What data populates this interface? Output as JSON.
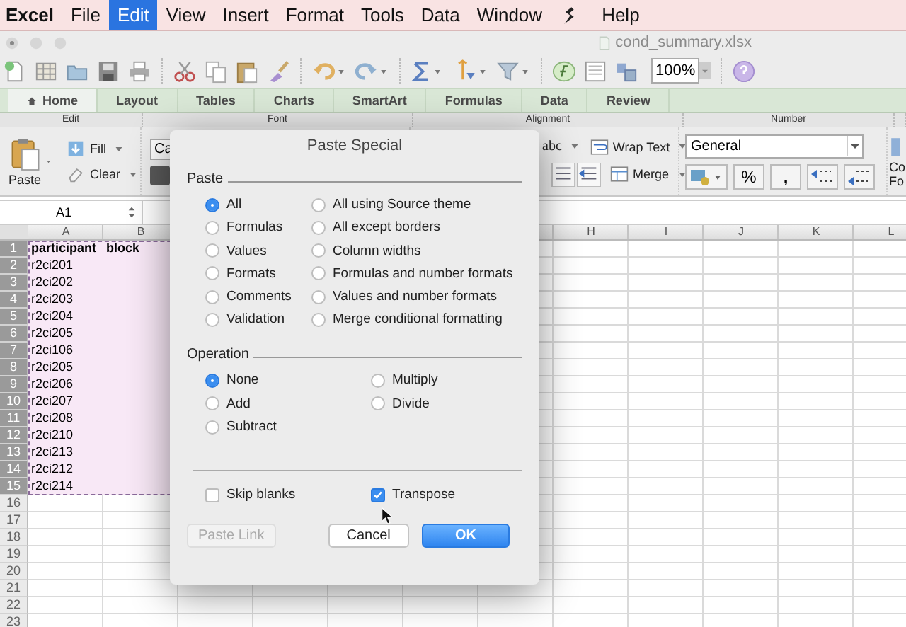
{
  "menu_bar": [
    {
      "kind": "app",
      "label": "Excel",
      "selected": false
    },
    {
      "kind": "menu",
      "label": "File",
      "selected": false
    },
    {
      "kind": "menu",
      "label": "Edit",
      "selected": true
    },
    {
      "kind": "menu",
      "label": "View",
      "selected": false
    },
    {
      "kind": "menu",
      "label": "Insert",
      "selected": false
    },
    {
      "kind": "menu",
      "label": "Format",
      "selected": false
    },
    {
      "kind": "menu",
      "label": "Tools",
      "selected": false
    },
    {
      "kind": "menu",
      "label": "Data",
      "selected": false
    },
    {
      "kind": "menu",
      "label": "Window",
      "selected": false
    },
    {
      "kind": "script",
      "selected": false
    },
    {
      "kind": "menu",
      "label": "Help",
      "selected": false
    }
  ],
  "window": {
    "title": "cond_summary.xlsx"
  },
  "toolbar": {
    "zoom": "100%"
  },
  "ribbon": {
    "tabs": [
      {
        "label": "Home",
        "selected": true
      },
      {
        "label": "Layout",
        "selected": false
      },
      {
        "label": "Tables",
        "selected": false
      },
      {
        "label": "Charts",
        "selected": false
      },
      {
        "label": "SmartArt",
        "selected": false
      },
      {
        "label": "Formulas",
        "selected": false
      },
      {
        "label": "Data",
        "selected": false
      },
      {
        "label": "Review",
        "selected": false
      }
    ],
    "groups": [
      "Edit",
      "Font",
      "Alignment",
      "Number"
    ],
    "edit": {
      "paste": "Paste",
      "fill": "Fill",
      "clear": "Clear"
    },
    "font": {
      "font_name": "Ca"
    },
    "alignment": {
      "orientation": "abc",
      "wrap_text": "Wrap Text",
      "merge": "Merge"
    },
    "number": {
      "format": "General",
      "percent": "%",
      "comma": ","
    },
    "cut_off_label": [
      "Co",
      "Fo"
    ]
  },
  "formula_bar": {
    "name_box": "A1"
  },
  "sheet": {
    "columns_left": [
      "A",
      "B"
    ],
    "columns_right": [
      "H",
      "I",
      "J",
      "K",
      "L"
    ],
    "rows": [
      {
        "number": "1",
        "kind": "header",
        "selected": true,
        "cells": [
          "participant",
          "block"
        ]
      },
      {
        "number": "2",
        "kind": "data",
        "selected": true,
        "cells": [
          "r2ci201"
        ]
      },
      {
        "number": "3",
        "kind": "data",
        "selected": true,
        "cells": [
          "r2ci202"
        ]
      },
      {
        "number": "4",
        "kind": "data",
        "selected": true,
        "cells": [
          "r2ci203"
        ]
      },
      {
        "number": "5",
        "kind": "data",
        "selected": true,
        "cells": [
          "r2ci204"
        ]
      },
      {
        "number": "6",
        "kind": "data",
        "selected": true,
        "cells": [
          "r2ci205"
        ]
      },
      {
        "number": "7",
        "kind": "data",
        "selected": true,
        "cells": [
          "r2ci106"
        ]
      },
      {
        "number": "8",
        "kind": "data",
        "selected": true,
        "cells": [
          "r2ci205"
        ]
      },
      {
        "number": "9",
        "kind": "data",
        "selected": true,
        "cells": [
          "r2ci206"
        ]
      },
      {
        "number": "10",
        "kind": "data",
        "selected": true,
        "cells": [
          "r2ci207"
        ]
      },
      {
        "number": "11",
        "kind": "data",
        "selected": true,
        "cells": [
          "r2ci208"
        ]
      },
      {
        "number": "12",
        "kind": "data",
        "selected": true,
        "cells": [
          "r2ci210"
        ]
      },
      {
        "number": "13",
        "kind": "data",
        "selected": true,
        "cells": [
          "r2ci213"
        ]
      },
      {
        "number": "14",
        "kind": "data",
        "selected": true,
        "cells": [
          "r2ci212"
        ]
      },
      {
        "number": "15",
        "kind": "data",
        "selected": true,
        "cells": [
          "r2ci214"
        ]
      },
      {
        "number": "16",
        "selected": false
      },
      {
        "number": "17",
        "selected": false
      },
      {
        "number": "18",
        "selected": false
      },
      {
        "number": "19",
        "selected": false
      },
      {
        "number": "20",
        "selected": false
      },
      {
        "number": "21",
        "selected": false
      },
      {
        "number": "22",
        "selected": false
      },
      {
        "number": "23",
        "selected": false
      }
    ]
  },
  "dialog": {
    "title": "Paste Special",
    "paste": {
      "label": "Paste",
      "options": [
        {
          "label": "All",
          "selected": true
        },
        {
          "label": "All using Source theme",
          "selected": false
        },
        {
          "label": "Formulas",
          "selected": false
        },
        {
          "label": "All except borders",
          "selected": false
        },
        {
          "label": "Values",
          "selected": false
        },
        {
          "label": "Column widths",
          "selected": false
        },
        {
          "label": "Formats",
          "selected": false
        },
        {
          "label": "Formulas and number formats",
          "selected": false
        },
        {
          "label": "Comments",
          "selected": false
        },
        {
          "label": "Values and number formats",
          "selected": false
        },
        {
          "label": "Validation",
          "selected": false
        },
        {
          "label": "Merge conditional formatting",
          "selected": false
        }
      ]
    },
    "operation": {
      "label": "Operation",
      "options": [
        {
          "label": "None",
          "selected": true
        },
        {
          "label": "Multiply",
          "selected": false
        },
        {
          "label": "Add",
          "selected": false
        },
        {
          "label": "Divide",
          "selected": false
        },
        {
          "label": "Subtract",
          "selected": false
        }
      ]
    },
    "checkboxes": [
      {
        "label": "Skip blanks",
        "checked": false
      },
      {
        "label": "Transpose",
        "checked": true
      }
    ],
    "buttons": [
      {
        "label": "Paste Link",
        "kind": "plain",
        "disabled": true
      },
      {
        "label": "Cancel",
        "kind": "plain",
        "disabled": false
      },
      {
        "label": "OK",
        "kind": "default",
        "disabled": false
      }
    ]
  }
}
